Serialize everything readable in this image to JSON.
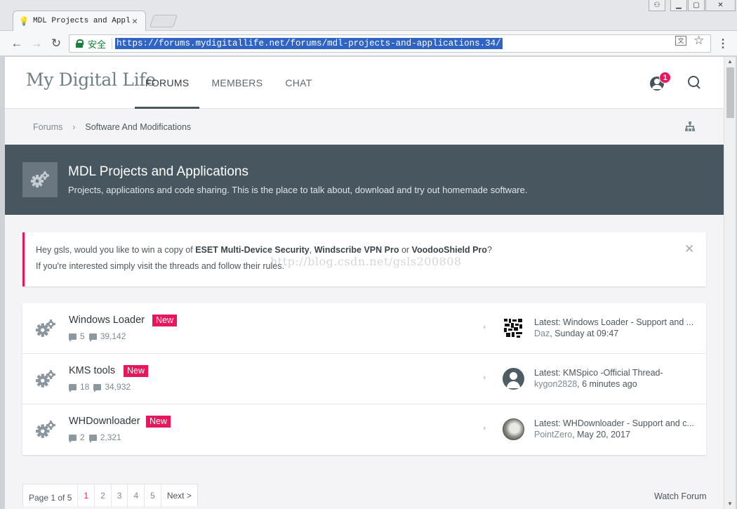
{
  "browser": {
    "tab_title": "MDL Projects and Appli",
    "secure_label": "安全",
    "url": "https://forums.mydigitallife.net/forums/mdl-projects-and-applications.34/"
  },
  "site": {
    "logo": "My Digital Life",
    "nav": [
      "FORUMS",
      "MEMBERS",
      "CHAT"
    ],
    "notification_count": "1"
  },
  "breadcrumb": {
    "root": "Forums",
    "current": "Software And Modifications"
  },
  "banner": {
    "title": "MDL Projects and Applications",
    "description": "Projects, applications and code sharing. This is the place to talk about, download and try out homemade software."
  },
  "notice": {
    "prefix": "Hey gsls, would you like to win a copy of ",
    "product1": "ESET Multi-Device Security",
    "comma": ", ",
    "product2": "Windscribe VPN Pro",
    "or": " or ",
    "product3": "VoodooShield Pro",
    "suffix": "?",
    "line2": "If you're interested simply visit the threads and follow their rules."
  },
  "watermark": "http://blog.csdn.net/gsls200808",
  "forums": [
    {
      "title": "Windows Loader",
      "badge": "New",
      "threads": "5",
      "messages": "39,142",
      "latest": "Latest: Windows Loader - Support and ...",
      "user": "Daz",
      "time": ", Sunday at 09:47"
    },
    {
      "title": "KMS tools",
      "badge": "New",
      "threads": "18",
      "messages": "34,932",
      "latest": "Latest: KMSpico -Official Thread-",
      "user": "kygon2828",
      "time": ", 6 minutes ago"
    },
    {
      "title": "WHDownloader",
      "badge": "New",
      "threads": "2",
      "messages": "2,321",
      "latest": "Latest: WHDownloader - Support and c...",
      "user": "PointZero",
      "time": ", May 20, 2017"
    }
  ],
  "pager": {
    "label": "Page 1 of 5",
    "pages": [
      "1",
      "2",
      "3",
      "4",
      "5"
    ],
    "next": "Next >"
  },
  "watch_forum": "Watch Forum"
}
